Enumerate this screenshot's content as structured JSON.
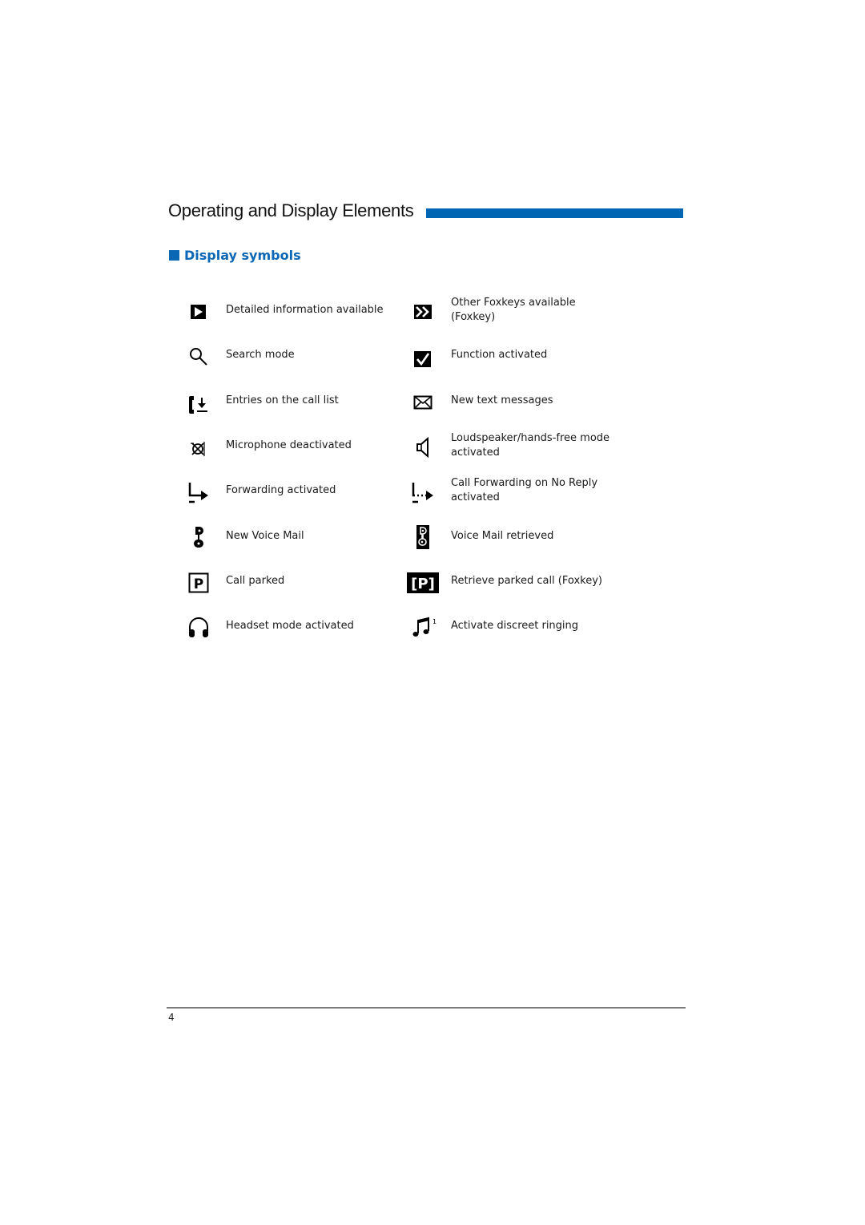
{
  "header": {
    "title": "Operating and Display Elements",
    "accent_color": "#0066b3"
  },
  "section": {
    "heading": "Display symbols"
  },
  "symbols": {
    "left": [
      {
        "icon": "detail-arrow-icon",
        "lines": [
          "Detailed information available"
        ]
      },
      {
        "icon": "search-icon",
        "lines": [
          "Search mode"
        ]
      },
      {
        "icon": "call-list-icon",
        "lines": [
          "Entries on the call list"
        ]
      },
      {
        "icon": "microphone-off-icon",
        "lines": [
          "Microphone deactivated"
        ]
      },
      {
        "icon": "forwarding-icon",
        "lines": [
          "Forwarding activated"
        ]
      },
      {
        "icon": "voicemail-new-icon",
        "lines": [
          "New Voice Mail"
        ]
      },
      {
        "icon": "call-parked-icon",
        "lines": [
          "Call parked"
        ]
      },
      {
        "icon": "headset-icon",
        "lines": [
          "Headset mode activated"
        ]
      }
    ],
    "right": [
      {
        "icon": "more-foxkeys-icon",
        "lines": [
          "Other Foxkeys available",
          "(Foxkey)"
        ]
      },
      {
        "icon": "checkmark-icon",
        "lines": [
          "Function activated"
        ]
      },
      {
        "icon": "envelope-icon",
        "lines": [
          "New text messages"
        ]
      },
      {
        "icon": "loudspeaker-icon",
        "lines": [
          "Loudspeaker/hands-free mode",
          "activated"
        ]
      },
      {
        "icon": "forwarding-no-reply-icon",
        "lines": [
          "Call Forwarding on No Reply",
          "activated"
        ]
      },
      {
        "icon": "voicemail-retrieved-icon",
        "lines": [
          "Voice Mail retrieved"
        ]
      },
      {
        "icon": "retrieve-parked-icon",
        "lines": [
          "Retrieve parked call (Foxkey)"
        ]
      },
      {
        "icon": "discreet-ringing-icon",
        "lines": [
          "Activate discreet ringing"
        ],
        "superscript": "1"
      }
    ]
  },
  "footer": {
    "page_number": "4"
  }
}
